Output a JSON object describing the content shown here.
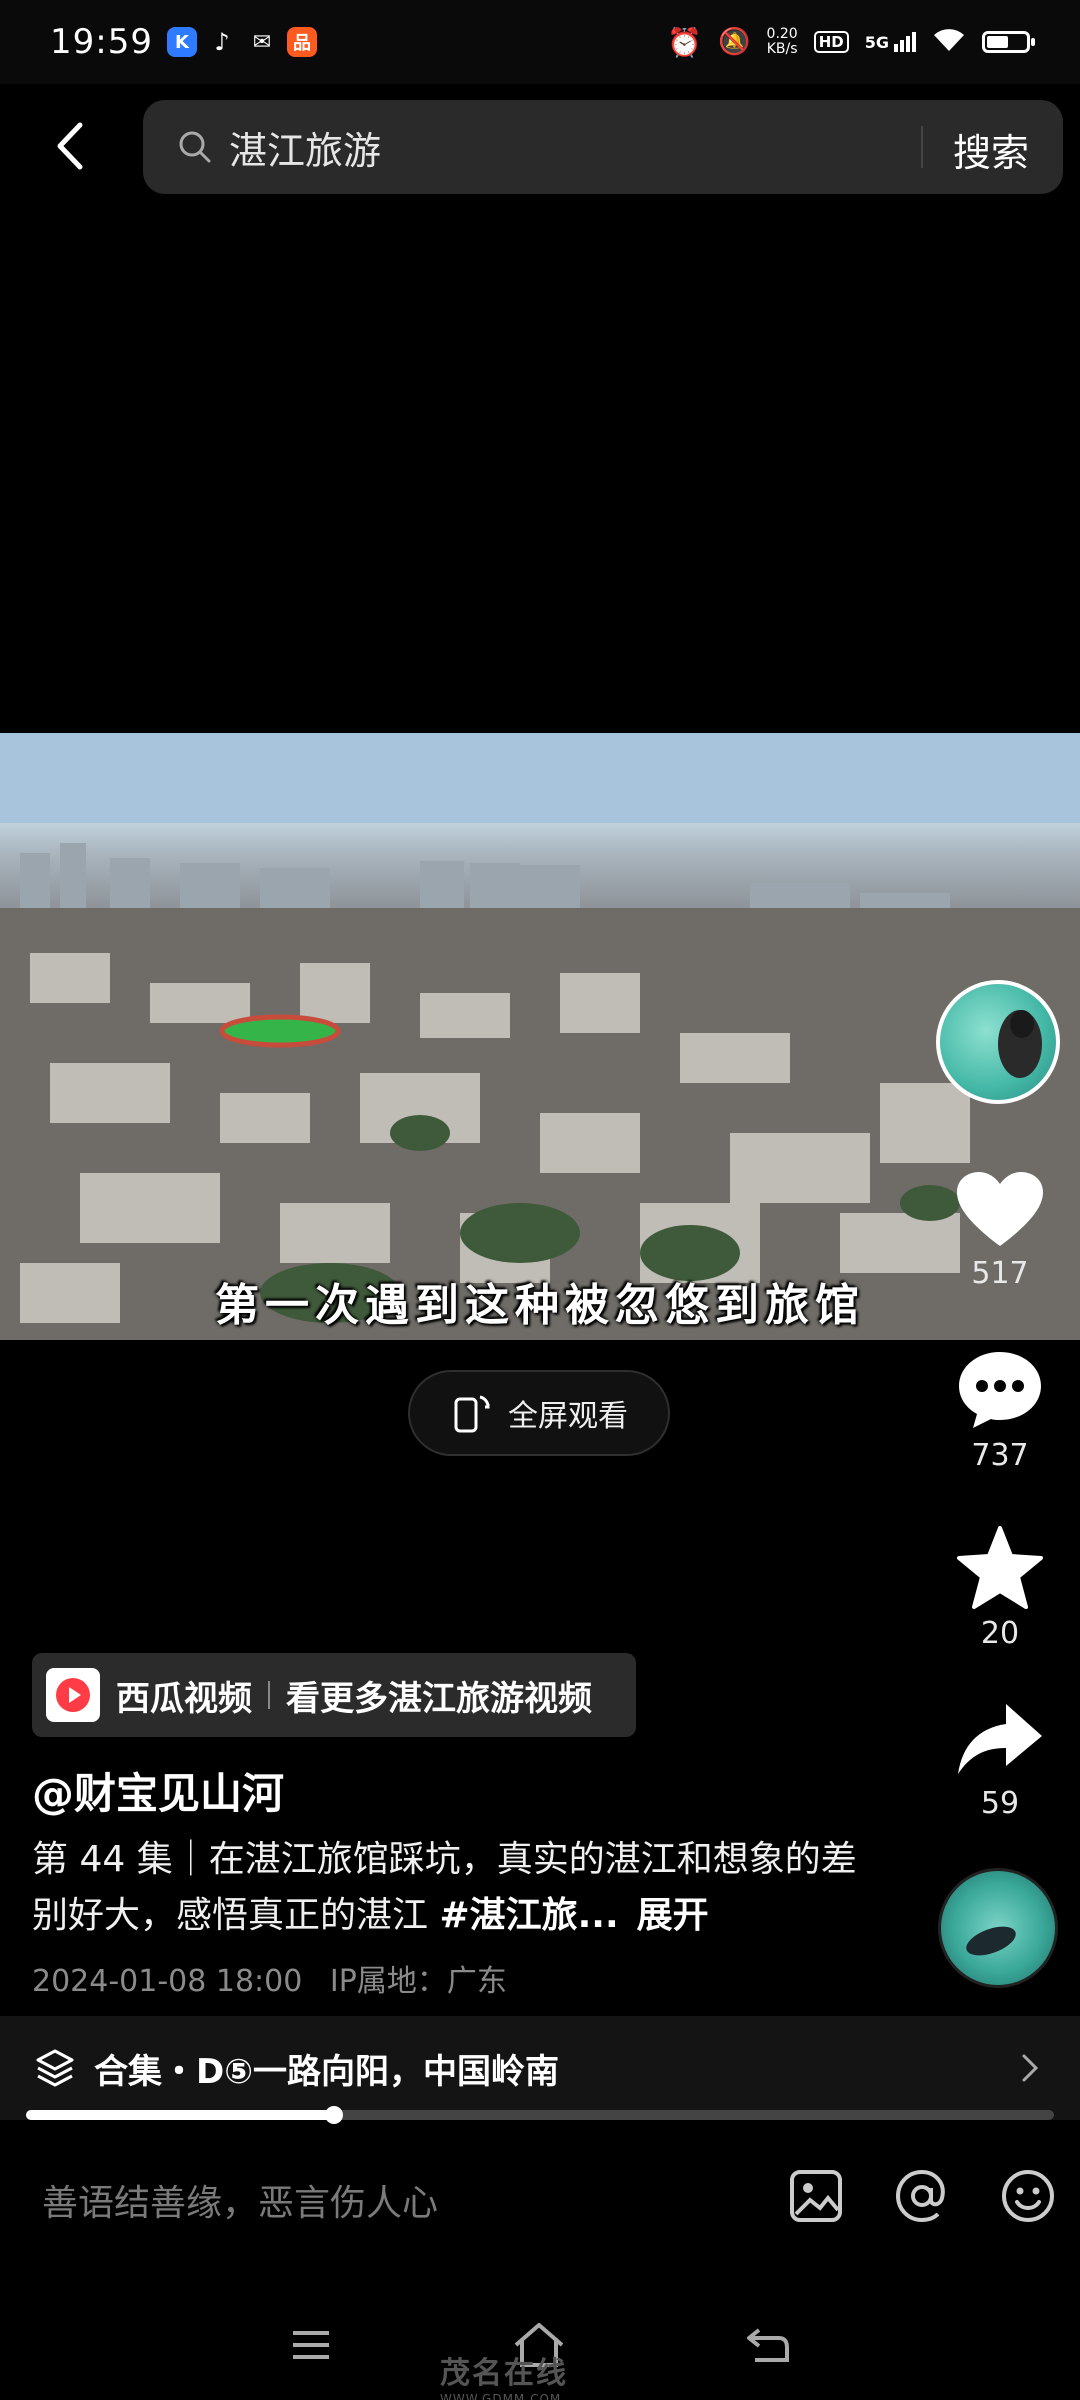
{
  "status": {
    "time": "19:59",
    "net_speed": "0.20",
    "net_unit": "KB/s",
    "hd": "HD",
    "signal": "5G",
    "battery_level": 0.6
  },
  "header": {
    "search_query": "湛江旅游",
    "search_button": "搜索"
  },
  "video": {
    "subtitle": "第一次遇到这种被忽悠到旅馆",
    "fullscreen_label": "全屏观看"
  },
  "rail": {
    "likes": "517",
    "comments": "737",
    "favorites": "20",
    "shares": "59"
  },
  "info": {
    "xigua_name": "西瓜视频",
    "xigua_more": "看更多湛江旅游视频",
    "author": "@财宝见山河",
    "desc_text": "第 44 集｜在湛江旅馆踩坑，真实的湛江和想象的差别好大，感悟真正的湛江 ",
    "desc_hashtag": "#湛江旅...",
    "desc_expand": "展开",
    "date": "2024-01-08 18:00",
    "ip_location": "IP属地：广东",
    "collection": "合集・D⑤一路向阳，中国岭南"
  },
  "progress": {
    "played_fraction": 0.3
  },
  "comment": {
    "placeholder": "善语结善缘，恶言伤人心"
  },
  "watermark": {
    "text": "茂名在线",
    "url": "WWW.GDMM.COM"
  },
  "colors": {
    "background": "#000000",
    "panel": "#2a2a2a",
    "muted": "#8a8a8a"
  }
}
